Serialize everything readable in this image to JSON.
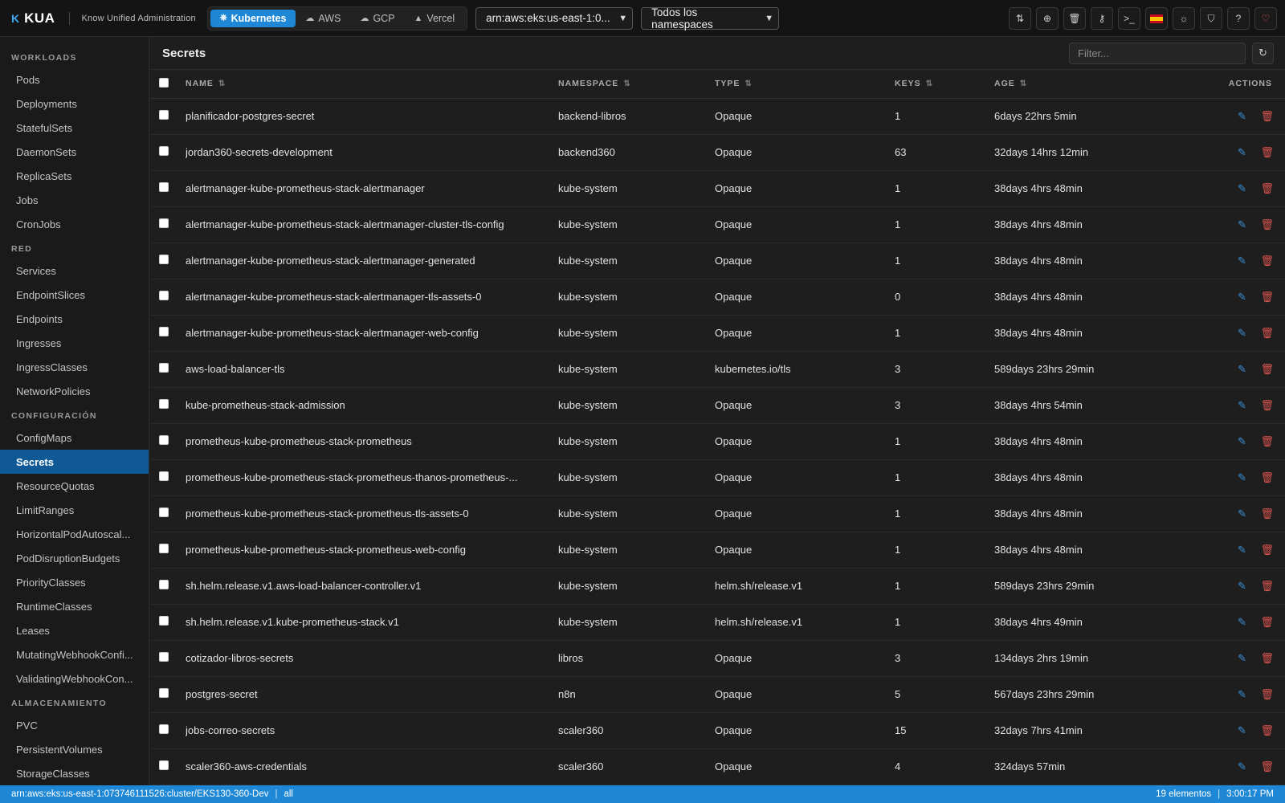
{
  "brand": {
    "logo": "K",
    "name": "KUA",
    "subtitle": "Know Unified Administration"
  },
  "providers": [
    {
      "label": "Kubernetes",
      "icon": "⎈",
      "active": true
    },
    {
      "label": "AWS",
      "icon": "☁",
      "active": false
    },
    {
      "label": "GCP",
      "icon": "☁",
      "active": false
    },
    {
      "label": "Vercel",
      "icon": "▲",
      "active": false
    }
  ],
  "cluster_select": {
    "value": "arn:aws:eks:us-east-1:0..."
  },
  "namespace_select": {
    "value": "Todos los namespaces"
  },
  "toolbar_icons": [
    "sort-icon",
    "add-icon",
    "trash-icon",
    "key-icon",
    "terminal-icon",
    "flag-es-icon",
    "sun-icon",
    "shield-icon",
    "help-icon",
    "heart-icon"
  ],
  "sidebar": {
    "sections": [
      {
        "title": "WORKLOADS",
        "items": [
          "Pods",
          "Deployments",
          "StatefulSets",
          "DaemonSets",
          "ReplicaSets",
          "Jobs",
          "CronJobs"
        ]
      },
      {
        "title": "RED",
        "items": [
          "Services",
          "EndpointSlices",
          "Endpoints",
          "Ingresses",
          "IngressClasses",
          "NetworkPolicies"
        ]
      },
      {
        "title": "CONFIGURACIÓN",
        "items": [
          "ConfigMaps",
          "Secrets",
          "ResourceQuotas",
          "LimitRanges",
          "HorizontalPodAutoscal...",
          "PodDisruptionBudgets",
          "PriorityClasses",
          "RuntimeClasses",
          "Leases",
          "MutatingWebhookConfi...",
          "ValidatingWebhookCon..."
        ]
      },
      {
        "title": "ALMACENAMIENTO",
        "items": [
          "PVC",
          "PersistentVolumes",
          "StorageClasses"
        ]
      }
    ],
    "active_item": "Secrets"
  },
  "main": {
    "title": "Secrets",
    "filter_placeholder": "Filter...",
    "columns": {
      "name": "NAME",
      "namespace": "NAMESPACE",
      "type": "TYPE",
      "keys": "KEYS",
      "age": "AGE",
      "actions": "ACTIONS"
    },
    "rows": [
      {
        "name": "planificador-postgres-secret",
        "namespace": "backend-libros",
        "type": "Opaque",
        "keys": "1",
        "age": "6days 22hrs 5min"
      },
      {
        "name": "jordan360-secrets-development",
        "namespace": "backend360",
        "type": "Opaque",
        "keys": "63",
        "age": "32days 14hrs 12min"
      },
      {
        "name": "alertmanager-kube-prometheus-stack-alertmanager",
        "namespace": "kube-system",
        "type": "Opaque",
        "keys": "1",
        "age": "38days 4hrs 48min"
      },
      {
        "name": "alertmanager-kube-prometheus-stack-alertmanager-cluster-tls-config",
        "namespace": "kube-system",
        "type": "Opaque",
        "keys": "1",
        "age": "38days 4hrs 48min"
      },
      {
        "name": "alertmanager-kube-prometheus-stack-alertmanager-generated",
        "namespace": "kube-system",
        "type": "Opaque",
        "keys": "1",
        "age": "38days 4hrs 48min"
      },
      {
        "name": "alertmanager-kube-prometheus-stack-alertmanager-tls-assets-0",
        "namespace": "kube-system",
        "type": "Opaque",
        "keys": "0",
        "age": "38days 4hrs 48min"
      },
      {
        "name": "alertmanager-kube-prometheus-stack-alertmanager-web-config",
        "namespace": "kube-system",
        "type": "Opaque",
        "keys": "1",
        "age": "38days 4hrs 48min"
      },
      {
        "name": "aws-load-balancer-tls",
        "namespace": "kube-system",
        "type": "kubernetes.io/tls",
        "keys": "3",
        "age": "589days 23hrs 29min"
      },
      {
        "name": "kube-prometheus-stack-admission",
        "namespace": "kube-system",
        "type": "Opaque",
        "keys": "3",
        "age": "38days 4hrs 54min"
      },
      {
        "name": "prometheus-kube-prometheus-stack-prometheus",
        "namespace": "kube-system",
        "type": "Opaque",
        "keys": "1",
        "age": "38days 4hrs 48min"
      },
      {
        "name": "prometheus-kube-prometheus-stack-prometheus-thanos-prometheus-...",
        "namespace": "kube-system",
        "type": "Opaque",
        "keys": "1",
        "age": "38days 4hrs 48min"
      },
      {
        "name": "prometheus-kube-prometheus-stack-prometheus-tls-assets-0",
        "namespace": "kube-system",
        "type": "Opaque",
        "keys": "1",
        "age": "38days 4hrs 48min"
      },
      {
        "name": "prometheus-kube-prometheus-stack-prometheus-web-config",
        "namespace": "kube-system",
        "type": "Opaque",
        "keys": "1",
        "age": "38days 4hrs 48min"
      },
      {
        "name": "sh.helm.release.v1.aws-load-balancer-controller.v1",
        "namespace": "kube-system",
        "type": "helm.sh/release.v1",
        "keys": "1",
        "age": "589days 23hrs 29min"
      },
      {
        "name": "sh.helm.release.v1.kube-prometheus-stack.v1",
        "namespace": "kube-system",
        "type": "helm.sh/release.v1",
        "keys": "1",
        "age": "38days 4hrs 49min"
      },
      {
        "name": "cotizador-libros-secrets",
        "namespace": "libros",
        "type": "Opaque",
        "keys": "3",
        "age": "134days 2hrs 19min"
      },
      {
        "name": "postgres-secret",
        "namespace": "n8n",
        "type": "Opaque",
        "keys": "5",
        "age": "567days 23hrs 29min"
      },
      {
        "name": "jobs-correo-secrets",
        "namespace": "scaler360",
        "type": "Opaque",
        "keys": "15",
        "age": "32days 7hrs 41min"
      },
      {
        "name": "scaler360-aws-credentials",
        "namespace": "scaler360",
        "type": "Opaque",
        "keys": "4",
        "age": "324days 57min"
      }
    ]
  },
  "statusbar": {
    "cluster": "arn:aws:eks:us-east-1:073746111526:cluster/EKS130-360-Dev",
    "namespace": "all",
    "count": "19 elementos",
    "time": "3:00:17 PM"
  },
  "colors": {
    "accent": "#1e88d6",
    "active_nav": "#0f5a96",
    "danger": "#d9534f"
  }
}
